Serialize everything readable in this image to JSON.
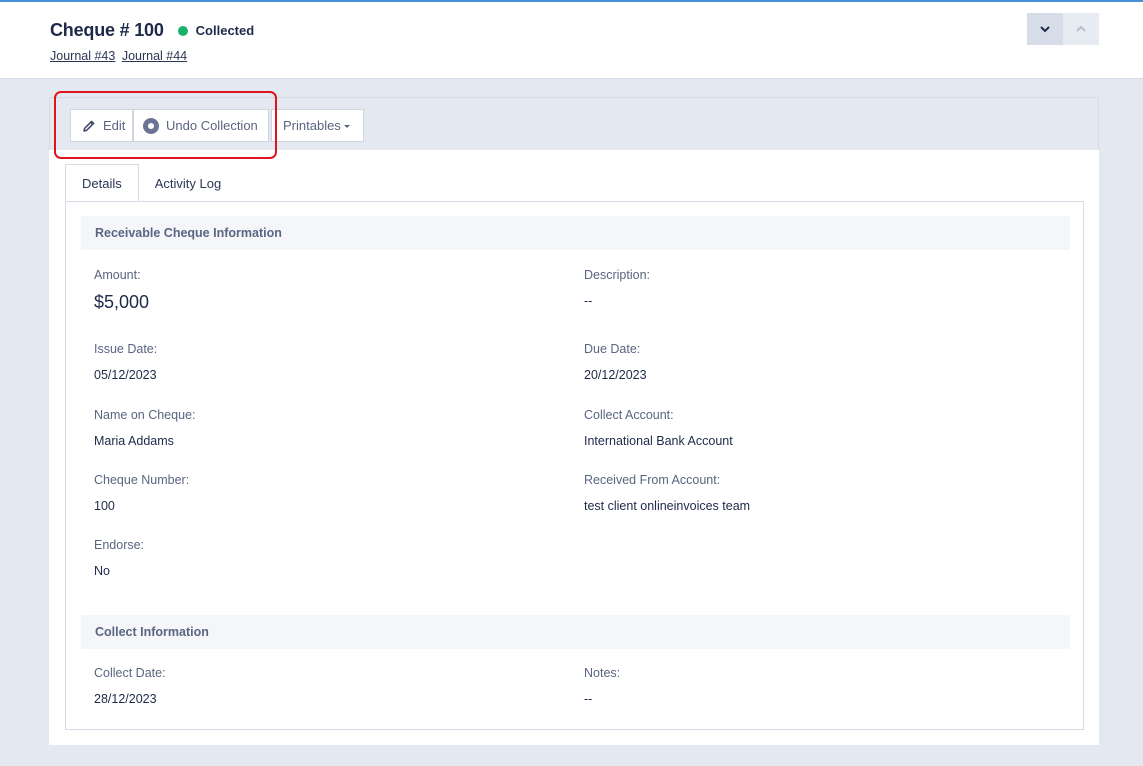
{
  "header": {
    "title": "Cheque # 100",
    "status": "Collected",
    "status_color": "#17b26a",
    "journal_links": [
      "Journal #43",
      "Journal #44"
    ],
    "nav_icons": [
      "chevron-down-icon",
      "chevron-up-icon"
    ]
  },
  "toolbar": {
    "edit_label": "Edit",
    "undo_label": "Undo Collection",
    "printables_label": "Printables"
  },
  "tabs": [
    {
      "label": "Details",
      "active": true
    },
    {
      "label": "Activity Log",
      "active": false
    }
  ],
  "cheque_section": {
    "title": "Receivable Cheque Information",
    "amount_label": "Amount:",
    "amount_value": "$5,000",
    "description_label": "Description:",
    "description_value": "--",
    "issue_date_label": "Issue Date:",
    "issue_date_value": "05/12/2023",
    "due_date_label": "Due Date:",
    "due_date_value": "20/12/2023",
    "name_label": "Name on Cheque:",
    "name_value": "Maria Addams",
    "collect_account_label": "Collect Account:",
    "collect_account_value": "International Bank Account",
    "cheque_number_label": "Cheque Number:",
    "cheque_number_value": "100",
    "received_from_label": "Received From Account:",
    "received_from_value": "test client onlineinvoices team",
    "endorse_label": "Endorse:",
    "endorse_value": "No"
  },
  "collect_section": {
    "title": "Collect Information",
    "collect_date_label": "Collect Date:",
    "collect_date_value": "28/12/2023",
    "notes_label": "Notes:",
    "notes_value": "--"
  }
}
